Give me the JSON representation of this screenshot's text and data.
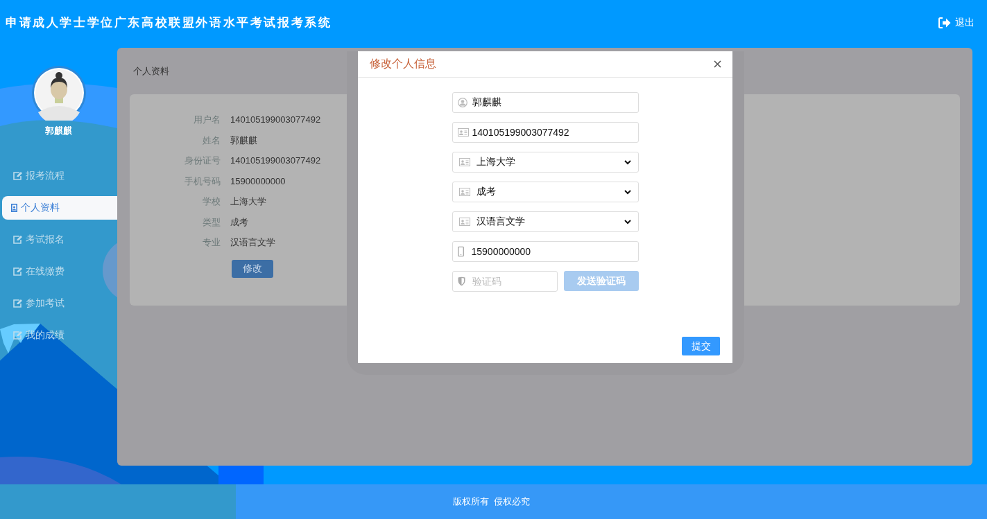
{
  "header": {
    "title": "申请成人学士学位广东高校联盟外语水平考试报考系统",
    "logout": "退出"
  },
  "user": {
    "name": "郭麒麒"
  },
  "sidebar": {
    "items": [
      {
        "label": "报考流程",
        "kind": "edit",
        "selected": false
      },
      {
        "label": "个人资料",
        "kind": "profile",
        "selected": true
      },
      {
        "label": "考试报名",
        "kind": "edit",
        "selected": false
      },
      {
        "label": "在线缴费",
        "kind": "edit",
        "selected": false
      },
      {
        "label": "参加考试",
        "kind": "edit",
        "selected": false
      },
      {
        "label": "我的成绩",
        "kind": "edit",
        "selected": false
      }
    ]
  },
  "panel": {
    "title": "个人资料",
    "fields": [
      {
        "label": "用户名",
        "value": "140105199003077492"
      },
      {
        "label": "姓名",
        "value": "郭麒麒"
      },
      {
        "label": "身份证号",
        "value": "140105199003077492"
      },
      {
        "label": "手机号码",
        "value": "15900000000"
      },
      {
        "label": "学校",
        "value": "上海大学"
      },
      {
        "label": "类型",
        "value": "成考"
      },
      {
        "label": "专业",
        "value": "汉语言文学"
      }
    ],
    "edit_button": "修改"
  },
  "dialog": {
    "title": "修改个人信息",
    "fields": [
      {
        "kind": "user",
        "value": "郭麒麒"
      },
      {
        "kind": "card",
        "value": "140105199003077492"
      },
      {
        "kind": "select",
        "value": "上海大学"
      },
      {
        "kind": "select",
        "value": "成考"
      },
      {
        "kind": "select",
        "value": "汉语言文学"
      },
      {
        "kind": "phone",
        "value": "15900000000"
      },
      {
        "kind": "code",
        "placeholder": "验证码",
        "button": "发送验证码",
        "disabled": true
      }
    ],
    "submit": "提交"
  },
  "footer": {
    "text": "版权所有  侵权必究"
  }
}
